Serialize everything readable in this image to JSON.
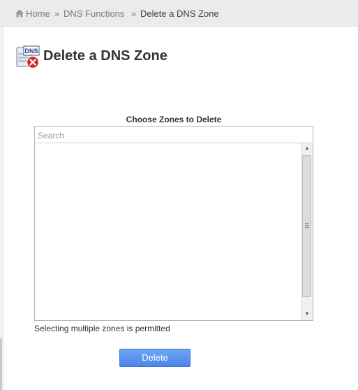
{
  "breadcrumb": {
    "home_label": "Home",
    "separator": "»",
    "dns_functions_label": "DNS Functions",
    "current_label": "Delete a DNS Zone"
  },
  "header": {
    "icon_text": "DNS",
    "title": "Delete a DNS Zone"
  },
  "zone_selector": {
    "label": "Choose Zones to Delete",
    "search_placeholder": "Search",
    "search_value": "",
    "zones": [],
    "hint": "Selecting multiple zones is permitted"
  },
  "actions": {
    "delete_label": "Delete"
  },
  "colors": {
    "button_blue": "#5b93ee",
    "breadcrumb_bg": "#ebebeb",
    "icon_red": "#d6272b"
  }
}
